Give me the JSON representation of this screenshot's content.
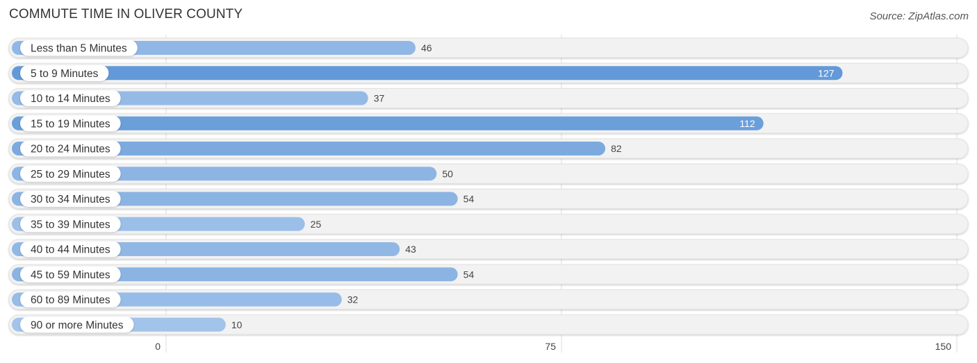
{
  "chart_data": {
    "type": "bar",
    "orientation": "horizontal",
    "title": "COMMUTE TIME IN OLIVER COUNTY",
    "source": "Source: ZipAtlas.com",
    "categories": [
      "Less than 5 Minutes",
      "5 to 9 Minutes",
      "10 to 14 Minutes",
      "15 to 19 Minutes",
      "20 to 24 Minutes",
      "25 to 29 Minutes",
      "30 to 34 Minutes",
      "35 to 39 Minutes",
      "40 to 44 Minutes",
      "45 to 59 Minutes",
      "60 to 89 Minutes",
      "90 or more Minutes"
    ],
    "values": [
      46,
      127,
      37,
      112,
      82,
      50,
      54,
      25,
      43,
      54,
      32,
      10
    ],
    "xlim": [
      0,
      150
    ],
    "xticks": [
      0,
      75,
      150
    ],
    "xtick_labels": [
      "0",
      "75",
      "150"
    ],
    "xlabel": "",
    "ylabel": "",
    "grid": true,
    "legend": "none",
    "colors": {
      "bar_strong": "#6399d8",
      "bar_light": "#a9c8ec",
      "track": "#f2f2f2",
      "label_pill": "#ffffff",
      "gridline": "#dddddd"
    }
  }
}
